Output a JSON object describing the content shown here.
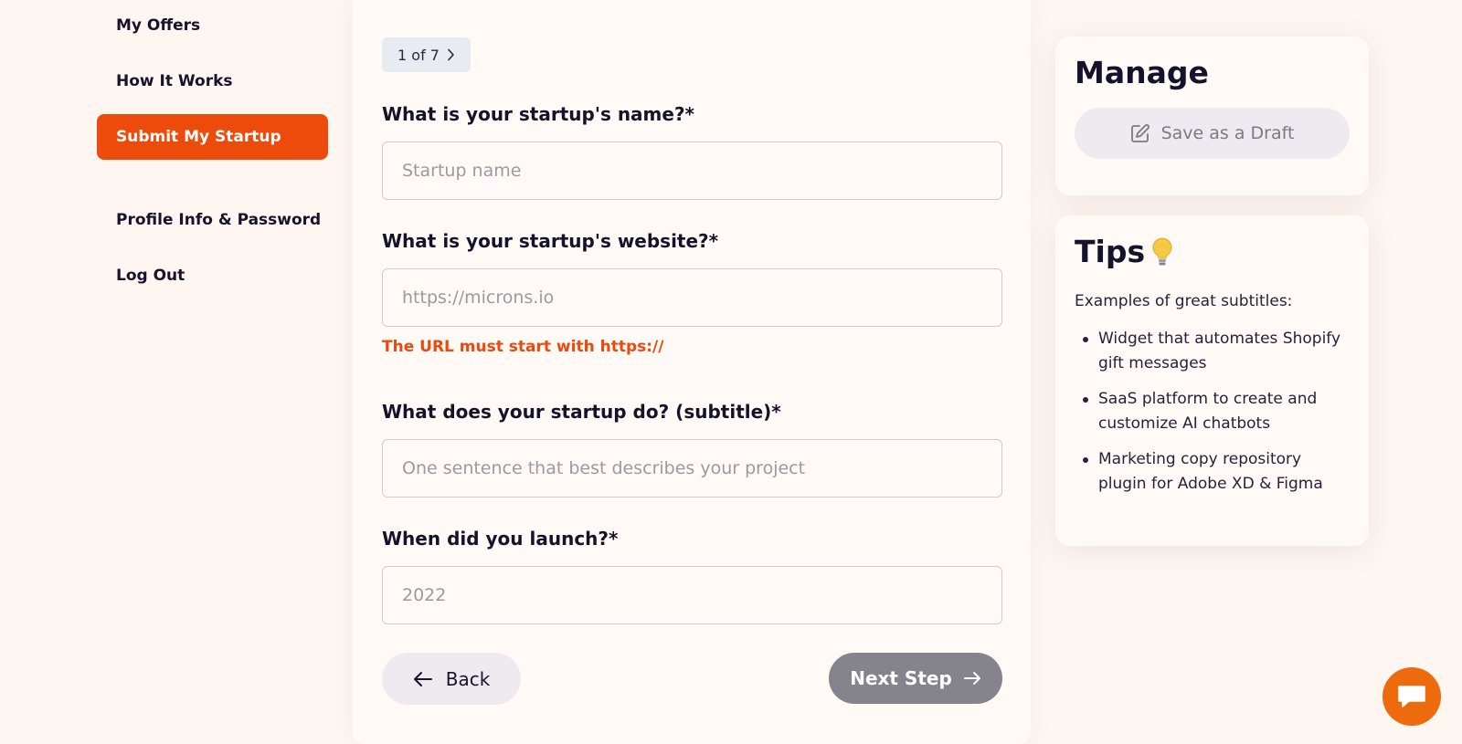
{
  "sidebar": {
    "items": [
      {
        "label": "My Offers",
        "active": false
      },
      {
        "label": "How It Works",
        "active": false
      },
      {
        "label": "Submit My Startup",
        "active": true
      },
      {
        "label": "Profile Info & Password",
        "active": false
      },
      {
        "label": "Log Out",
        "active": false
      }
    ],
    "active_color": "#ed4b0b"
  },
  "form": {
    "step": "1 of 7",
    "questions": [
      {
        "label": "What is your startup's name?*",
        "placeholder": "Startup name",
        "value": ""
      },
      {
        "label": "What is your startup's website?*",
        "placeholder": "https://microns.io",
        "value": ""
      },
      {
        "label": "What does your startup do? (subtitle)*",
        "placeholder": "One sentence that best describes your project",
        "value": ""
      },
      {
        "label": "When did you launch?*",
        "placeholder": "2022",
        "value": ""
      }
    ],
    "website_error": "The URL must start with https://",
    "error_color": "#ea4a0e",
    "back_label": "Back",
    "next_label": "Next Step"
  },
  "manage": {
    "title": "Manage",
    "draft_label": "Save as a Draft"
  },
  "tips": {
    "title": "Tips",
    "title_icon": "lightbulb-icon",
    "intro": "Examples of great subtitles:",
    "examples": [
      "Widget that automates Shopify gift messages",
      "SaaS platform to create and customize AI chatbots",
      "Marketing copy repository plugin for Adobe XD & Figma"
    ]
  },
  "chat": {
    "icon": "chat-bubble-icon",
    "color": "#ed6a0d"
  }
}
